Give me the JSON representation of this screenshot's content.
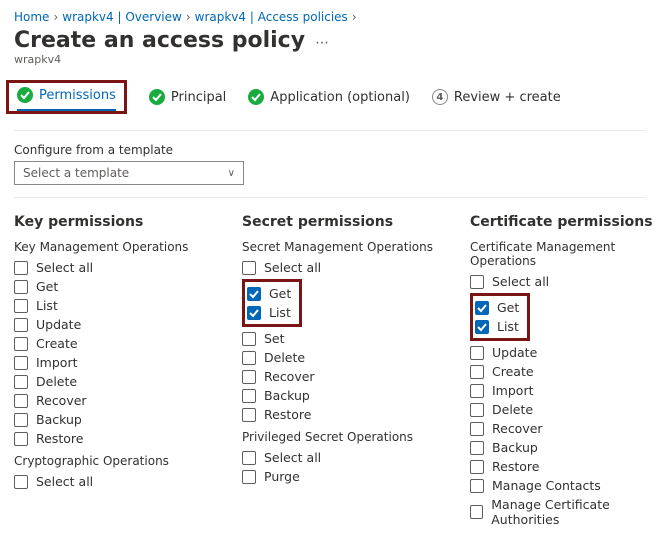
{
  "breadcrumbs": {
    "home": "Home",
    "kv_overview": "wrapkv4 | Overview",
    "access_policies": "wrapkv4 | Access policies"
  },
  "title": "Create an access policy",
  "subtitle": "wrapkv4",
  "tabs": {
    "permissions": "Permissions",
    "principal": "Principal",
    "application": "Application (optional)",
    "review": "Review + create",
    "review_num": "4"
  },
  "template_section": {
    "label": "Configure from a template",
    "placeholder": "Select a template"
  },
  "key": {
    "heading": "Key permissions",
    "mgmt": "Key Management Operations",
    "select_all": "Select all",
    "ops": {
      "get": "Get",
      "list": "List",
      "update": "Update",
      "create": "Create",
      "import": "Import",
      "delete": "Delete",
      "recover": "Recover",
      "backup": "Backup",
      "restore": "Restore"
    },
    "crypto": "Cryptographic Operations",
    "crypto_select_all": "Select all"
  },
  "secret": {
    "heading": "Secret permissions",
    "mgmt": "Secret Management Operations",
    "select_all": "Select all",
    "ops": {
      "get": "Get",
      "list": "List",
      "set": "Set",
      "delete": "Delete",
      "recover": "Recover",
      "backup": "Backup",
      "restore": "Restore"
    },
    "priv": "Privileged Secret Operations",
    "priv_select_all": "Select all",
    "priv_ops": {
      "purge": "Purge"
    }
  },
  "cert": {
    "heading": "Certificate permissions",
    "mgmt": "Certificate Management Operations",
    "select_all": "Select all",
    "ops": {
      "get": "Get",
      "list": "List",
      "update": "Update",
      "create": "Create",
      "import": "Import",
      "delete": "Delete",
      "recover": "Recover",
      "backup": "Backup",
      "restore": "Restore",
      "mcontacts": "Manage Contacts",
      "mca": "Manage Certificate Authorities"
    }
  }
}
